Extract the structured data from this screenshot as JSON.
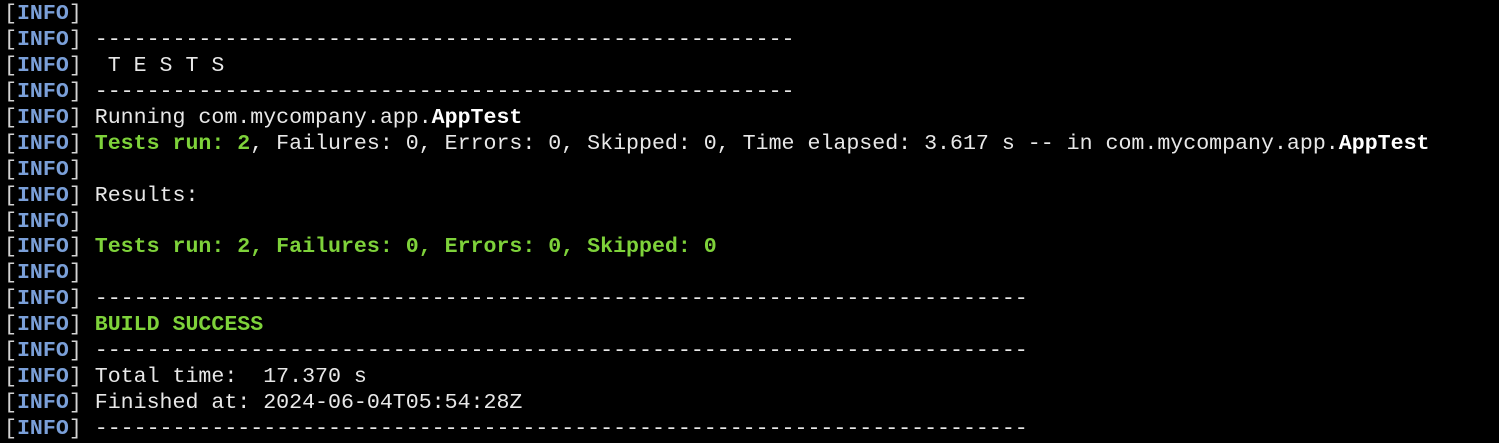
{
  "terminal": {
    "level": "INFO",
    "colors": {
      "background": "#000000",
      "text": "#e8e8e8",
      "level": "#7a9fd8",
      "success": "#7ed23a"
    },
    "lines": [
      {
        "segments": []
      },
      {
        "segments": [
          {
            "text": " ------------------------------------------------------",
            "style": "plain"
          }
        ]
      },
      {
        "segments": [
          {
            "text": "  T E S T S",
            "style": "plain"
          }
        ]
      },
      {
        "segments": [
          {
            "text": " ------------------------------------------------------",
            "style": "plain"
          }
        ]
      },
      {
        "segments": [
          {
            "text": " Running com.mycompany.app.",
            "style": "plain"
          },
          {
            "text": "AppTest",
            "style": "bold"
          }
        ]
      },
      {
        "segments": [
          {
            "text": " ",
            "style": "plain"
          },
          {
            "text": "Tests run: 2",
            "style": "green"
          },
          {
            "text": ", Failures: 0, Errors: 0, Skipped: 0, Time elapsed: 3.617 s -- in com.mycompany.app.",
            "style": "plain"
          },
          {
            "text": "AppTest",
            "style": "bold"
          }
        ]
      },
      {
        "segments": []
      },
      {
        "segments": [
          {
            "text": " Results:",
            "style": "plain"
          }
        ]
      },
      {
        "segments": []
      },
      {
        "segments": [
          {
            "text": " ",
            "style": "plain"
          },
          {
            "text": "Tests run: 2, Failures: 0, Errors: 0, Skipped: 0",
            "style": "green"
          }
        ]
      },
      {
        "segments": []
      },
      {
        "segments": [
          {
            "text": " ------------------------------------------------------------------------",
            "style": "plain"
          }
        ]
      },
      {
        "segments": [
          {
            "text": " ",
            "style": "plain"
          },
          {
            "text": "BUILD SUCCESS",
            "style": "green"
          }
        ]
      },
      {
        "segments": [
          {
            "text": " ------------------------------------------------------------------------",
            "style": "plain"
          }
        ]
      },
      {
        "segments": [
          {
            "text": " Total time:  17.370 s",
            "style": "plain"
          }
        ]
      },
      {
        "segments": [
          {
            "text": " Finished at: 2024-06-04T05:54:28Z",
            "style": "plain"
          }
        ]
      },
      {
        "segments": [
          {
            "text": " ------------------------------------------------------------------------",
            "style": "plain"
          }
        ]
      }
    ]
  }
}
